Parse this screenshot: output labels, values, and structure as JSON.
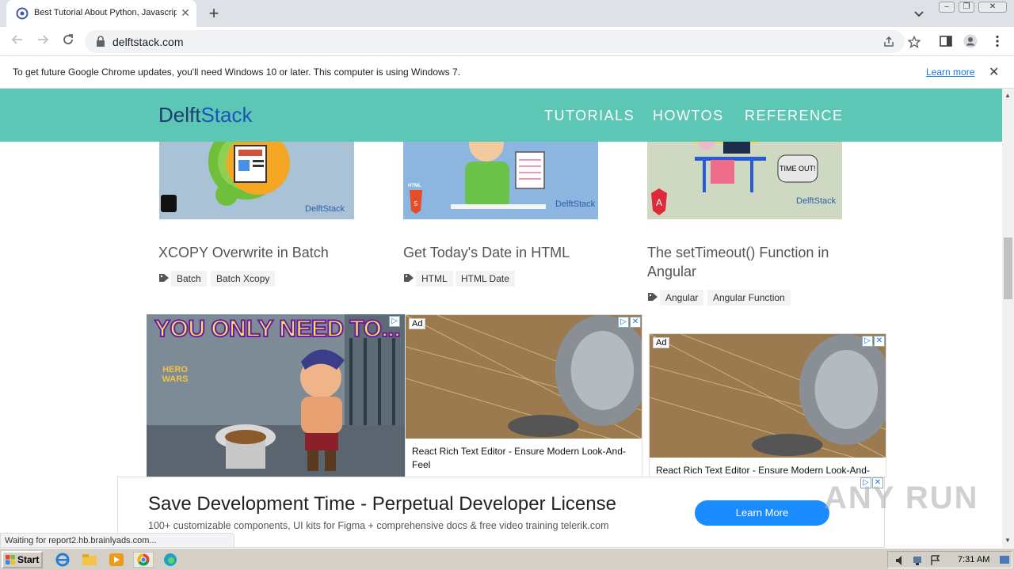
{
  "browser": {
    "tab_title": "Best Tutorial About Python, Javascript",
    "new_tab_label": "+",
    "close_tab_label": "✕",
    "url": "delftstack.com",
    "win_buttons": [
      "‒",
      "❐",
      "✕"
    ]
  },
  "infobar": {
    "message": "To get future Google Chrome updates, you'll need Windows 10 or later. This computer is using Windows 7.",
    "learn_more": "Learn more",
    "close": "✕"
  },
  "site": {
    "logo_part1": "Delft",
    "logo_part2": "Stack",
    "nav": [
      "TUTORIALS",
      "HOWTOS",
      "REFERENCE"
    ],
    "brand_watermark": "DelftStack"
  },
  "cards": [
    {
      "title": "XCOPY Overwrite in Batch",
      "tags": [
        "Batch",
        "Batch Xcopy"
      ]
    },
    {
      "title": "Get Today's Date in HTML",
      "tags": [
        "HTML",
        "HTML Date"
      ],
      "badge": "HTML"
    },
    {
      "title": "The setTimeout() Function in Angular",
      "tags": [
        "Angular",
        "Angular Function"
      ],
      "bubble": "TIME OUT!"
    }
  ],
  "ads": {
    "hero": {
      "headline": "YOU ONLY NEED TO...",
      "logo": "HERO WARS"
    },
    "ad_label": "Ad",
    "react_ad_1": "React Rich Text Editor - Ensure Modern Look-And-Feel",
    "react_ad_2": "React Rich Text Editor - Ensure Modern Look-And-",
    "bottom": {
      "title": "Save Development Time - Perpetual Developer License",
      "subtitle": "100+ customizable components, UI kits for Figma + comprehensive docs & free video training telerik.com",
      "cta": "Learn More"
    }
  },
  "status": "Waiting for report2.hb.brainlyads.com...",
  "watermark": "ANY RUN",
  "taskbar": {
    "start": "Start",
    "time": "7:31 AM"
  },
  "colors": {
    "site_nav": "#5bc7b4",
    "cta_blue": "#1a8cff",
    "link_blue": "#1a73e8"
  }
}
